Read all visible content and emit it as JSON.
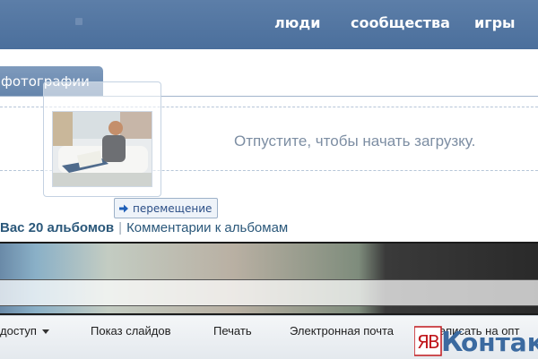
{
  "header": {
    "nav": [
      "люди",
      "сообщества",
      "игры"
    ]
  },
  "photos_tab": {
    "label": "фотографии"
  },
  "dropzone": {
    "hint": "Отпустите, чтобы начать загрузку."
  },
  "drag_tooltip": {
    "label": "перемещение",
    "icon": "arrow-right-icon"
  },
  "albums_bar": {
    "count_label": "Вас 20 альбомов",
    "comments_link": "Комментарии к альбомам"
  },
  "explorer_toolbar": {
    "items": [
      "доступ",
      "Показ слайдов",
      "Печать",
      "Электронная почта",
      "Записать на опт"
    ]
  },
  "watermark": {
    "logo_text": "ЯВКонтакте"
  },
  "colors": {
    "header_bg": "#5375a1",
    "tab_bg": "#6f8fb5",
    "link": "#2b587a",
    "drop_text": "#7d8ea3"
  }
}
